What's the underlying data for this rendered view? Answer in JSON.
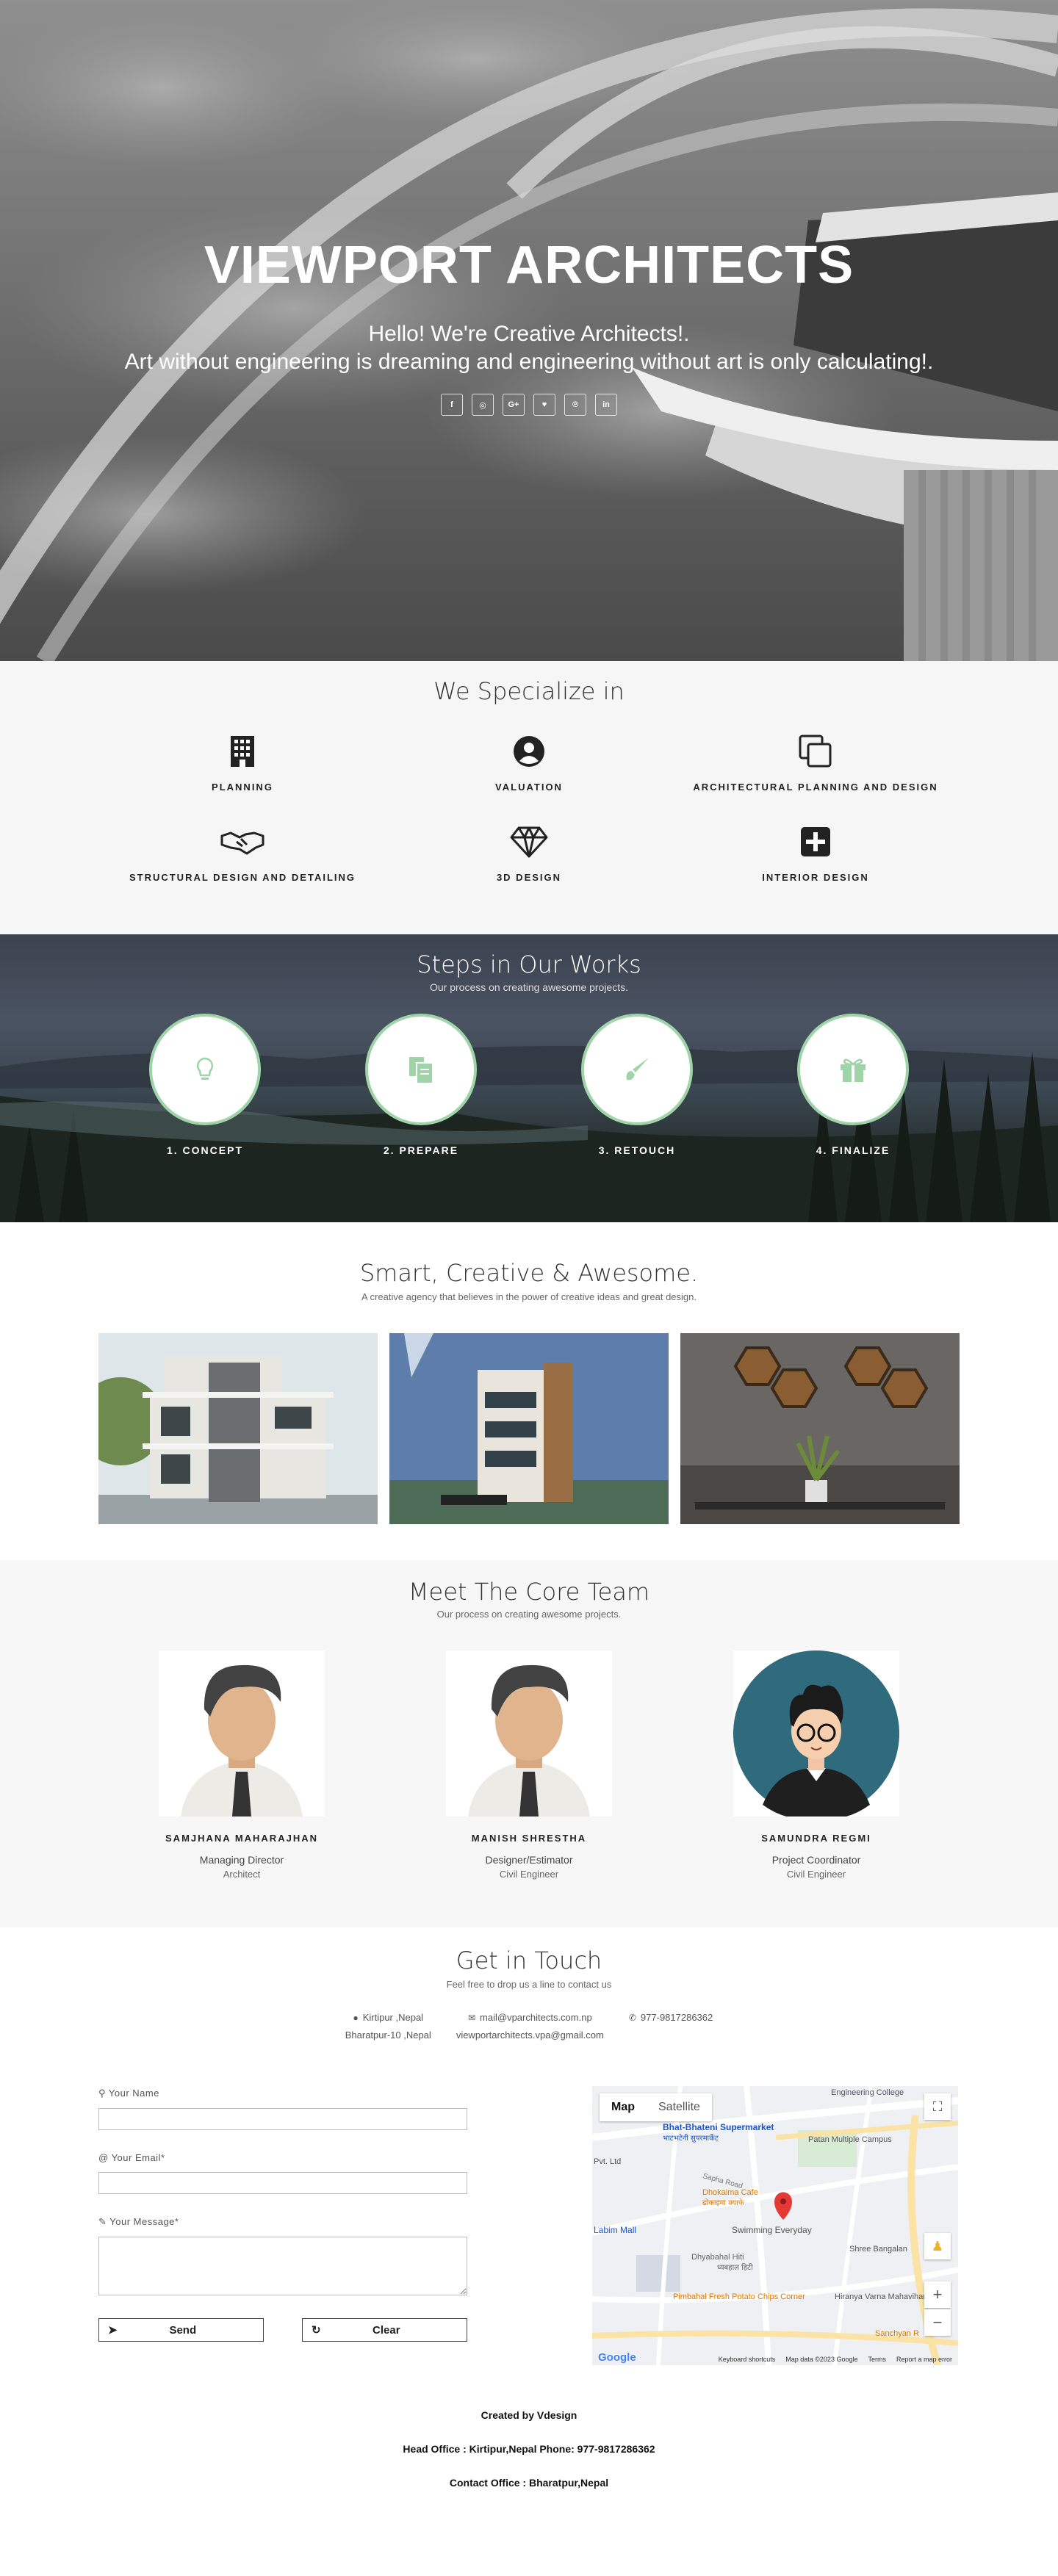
{
  "hero": {
    "title": "VIEWPORT ARCHITECTS",
    "subtitle": "Hello! We're Creative Architects!.",
    "tagline": "Art without engineering is dreaming and engineering without art is only calculating!.",
    "social": [
      {
        "icon": "facebook-icon",
        "glyph": "f"
      },
      {
        "icon": "instagram-icon",
        "glyph": "◎"
      },
      {
        "icon": "google-plus-icon",
        "glyph": "G+"
      },
      {
        "icon": "twitter-icon",
        "glyph": "♥"
      },
      {
        "icon": "pinterest-icon",
        "glyph": "℗"
      },
      {
        "icon": "linkedin-icon",
        "glyph": "in"
      }
    ]
  },
  "specialize": {
    "title": "We Specialize in",
    "items": [
      {
        "label": "PLANNING",
        "icon": "building-icon"
      },
      {
        "label": "VALUATION",
        "icon": "user-circle-icon"
      },
      {
        "label": "ARCHITECTURAL PLANNING AND DESIGN",
        "icon": "clone-icon"
      },
      {
        "label": "STRUCTURAL DESIGN AND DETAILING",
        "icon": "handshake-icon"
      },
      {
        "label": "3D DESIGN",
        "icon": "diamond-icon"
      },
      {
        "label": "INTERIOR DESIGN",
        "icon": "plus-square-icon"
      }
    ]
  },
  "steps": {
    "title": "Steps in Our Works",
    "subtitle": "Our process on creating awesome projects.",
    "items": [
      {
        "label": "1. CONCEPT",
        "icon": "lightbulb-icon"
      },
      {
        "label": "2. PREPARE",
        "icon": "files-icon"
      },
      {
        "label": "3. RETOUCH",
        "icon": "brush-icon"
      },
      {
        "label": "4. FINALIZE",
        "icon": "gift-icon"
      }
    ]
  },
  "smart": {
    "title": "Smart, Creative & Awesome.",
    "subtitle": "A creative agency that believes in the power of creative ideas and great design."
  },
  "team": {
    "title": "Meet The Core Team",
    "subtitle": "Our process on creating awesome projects.",
    "members": [
      {
        "name": "SAMJHANA MAHARAJHAN",
        "role": "Managing Director",
        "role2": "Architect"
      },
      {
        "name": "MANISH SHRESTHA",
        "role": "Designer/Estimator",
        "role2": "Civil Engineer"
      },
      {
        "name": "SAMUNDRA REGMI",
        "role": "Project Coordinator",
        "role2": "Civil Engineer"
      }
    ]
  },
  "contact": {
    "title": "Get in Touch",
    "subtitle": "Feel free to drop us a line to contact us",
    "address1": "Kirtipur ,Nepal",
    "address2": "Bharatpur-10 ,Nepal",
    "email1": "mail@vparchitects.com.np",
    "email2": "viewportarchitects.vpa@gmail.com",
    "phone": "977-9817286362",
    "form": {
      "name_label": "Your Name",
      "email_label": "Your Email*",
      "message_label": "Your Message*",
      "send": "Send",
      "clear": "Clear"
    },
    "map": {
      "tab_map": "Map",
      "tab_satellite": "Satellite",
      "footer_shortcuts": "Keyboard shortcuts",
      "footer_data": "Map data ©2023 Google",
      "footer_terms": "Terms",
      "footer_report": "Report a map error",
      "logo": "Google",
      "places": {
        "engineering": "Engineering College",
        "supermarket": "Bhat-Bhateni Supermarket",
        "supermarket_np": "भाटभटेनी सुपरमार्केट",
        "patan": "Patan Multiple Campus",
        "sapha": "Sapha Road",
        "dhokaima": "Dhokaima Cafe",
        "dhokaima_np": "ढोकाइमा क्याफे",
        "swimming": "Swimming Everyday",
        "labim": "Labim Mall",
        "ltd": "Pvt. Ltd",
        "dhyabahal": "Dhyabahal Hiti",
        "dhyabahal_np": "ध्यबहाल हिटी",
        "pimbahal": "Pimbahal Fresh Potato Chips Corner",
        "bangalan": "Shree Bangalan",
        "hiranya": "Hiranya Varna Mahavihar",
        "sanchyan": "Sanchyan R"
      }
    }
  },
  "footer": {
    "created_prefix": "Created by ",
    "created_by": "Vdesign",
    "head_office": "Head Office : Kirtipur,Nepal Phone: 977-9817286362",
    "contact_office": "Contact Office : Bharatpur,Nepal"
  },
  "colors": {
    "accent_green": "#9fd4a8",
    "dark": "#222222",
    "map_red": "#e53935"
  }
}
